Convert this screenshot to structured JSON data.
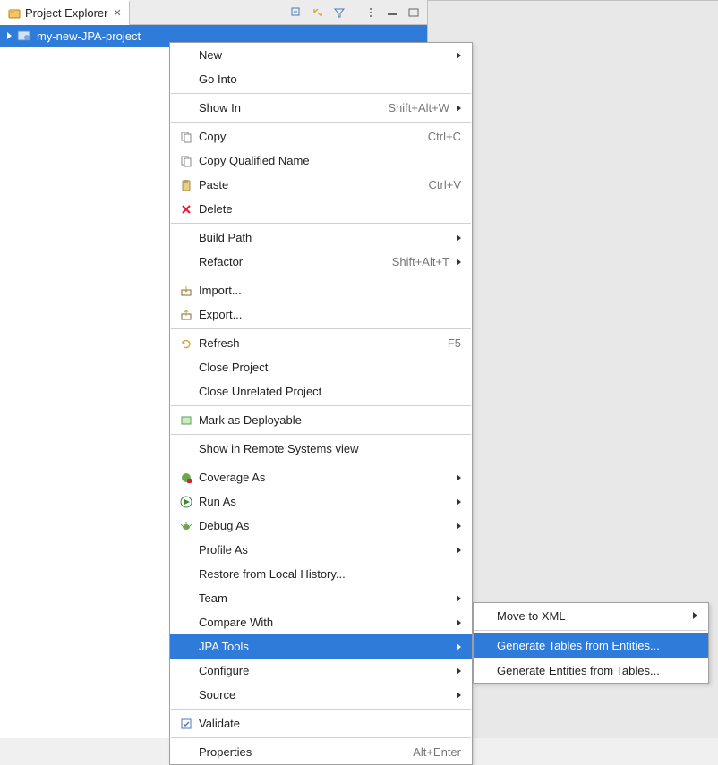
{
  "view": {
    "title": "Project Explorer"
  },
  "tree": {
    "project_name": "my-new-JPA-project"
  },
  "context_menu": {
    "new": "New",
    "go_into": "Go Into",
    "show_in": "Show In",
    "show_in_accel": "Shift+Alt+W",
    "copy": "Copy",
    "copy_accel": "Ctrl+C",
    "copy_qualified": "Copy Qualified Name",
    "paste": "Paste",
    "paste_accel": "Ctrl+V",
    "delete": "Delete",
    "build_path": "Build Path",
    "refactor": "Refactor",
    "refactor_accel": "Shift+Alt+T",
    "import": "Import...",
    "export": "Export...",
    "refresh": "Refresh",
    "refresh_accel": "F5",
    "close_project": "Close Project",
    "close_unrelated": "Close Unrelated Project",
    "mark_deployable": "Mark as Deployable",
    "show_remote": "Show in Remote Systems view",
    "coverage_as": "Coverage As",
    "run_as": "Run As",
    "debug_as": "Debug As",
    "profile_as": "Profile As",
    "restore_history": "Restore from Local History...",
    "team": "Team",
    "compare_with": "Compare With",
    "jpa_tools": "JPA Tools",
    "configure": "Configure",
    "source": "Source",
    "validate": "Validate",
    "properties": "Properties",
    "properties_accel": "Alt+Enter"
  },
  "submenu": {
    "move_xml": "Move to XML",
    "gen_tables": "Generate Tables from Entities...",
    "gen_entities": "Generate Entities from Tables..."
  }
}
